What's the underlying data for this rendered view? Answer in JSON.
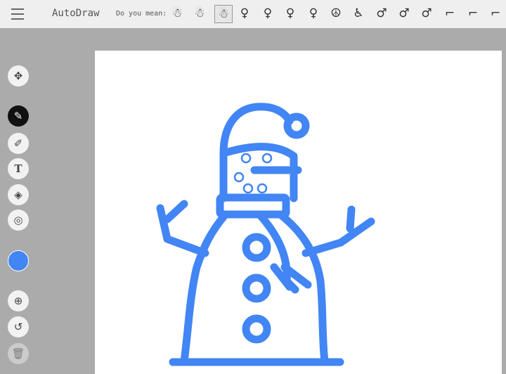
{
  "header": {
    "title": "AutoDraw",
    "prompt": "Do you mean:"
  },
  "suggestions": [
    {
      "name": "snowman-1",
      "glyph": "☃"
    },
    {
      "name": "snowman-2",
      "glyph": "☃"
    },
    {
      "name": "snowman-3",
      "glyph": "☃",
      "selected": true
    },
    {
      "name": "female-1",
      "glyph": "♀"
    },
    {
      "name": "female-2",
      "glyph": "♀"
    },
    {
      "name": "female-3",
      "glyph": "♀"
    },
    {
      "name": "female-4",
      "glyph": "♀"
    },
    {
      "name": "peace",
      "glyph": "☮"
    },
    {
      "name": "wheelchair",
      "glyph": "♿"
    },
    {
      "name": "male-1",
      "glyph": "♂"
    },
    {
      "name": "male-2",
      "glyph": "♂"
    },
    {
      "name": "male-3",
      "glyph": "♂"
    },
    {
      "name": "drill-1",
      "glyph": "⌐"
    },
    {
      "name": "drill-2",
      "glyph": "⌐"
    },
    {
      "name": "drill-3",
      "glyph": "⌐"
    }
  ],
  "tools": {
    "move": "✥",
    "autodraw": "✎",
    "draw": "✐",
    "type": "T",
    "fill": "◈",
    "shape": "◎",
    "zoom": "⊕",
    "undo": "↺",
    "delete": "🗑"
  },
  "colors": {
    "selected": "#4285f4",
    "accent": "#4285f4"
  }
}
